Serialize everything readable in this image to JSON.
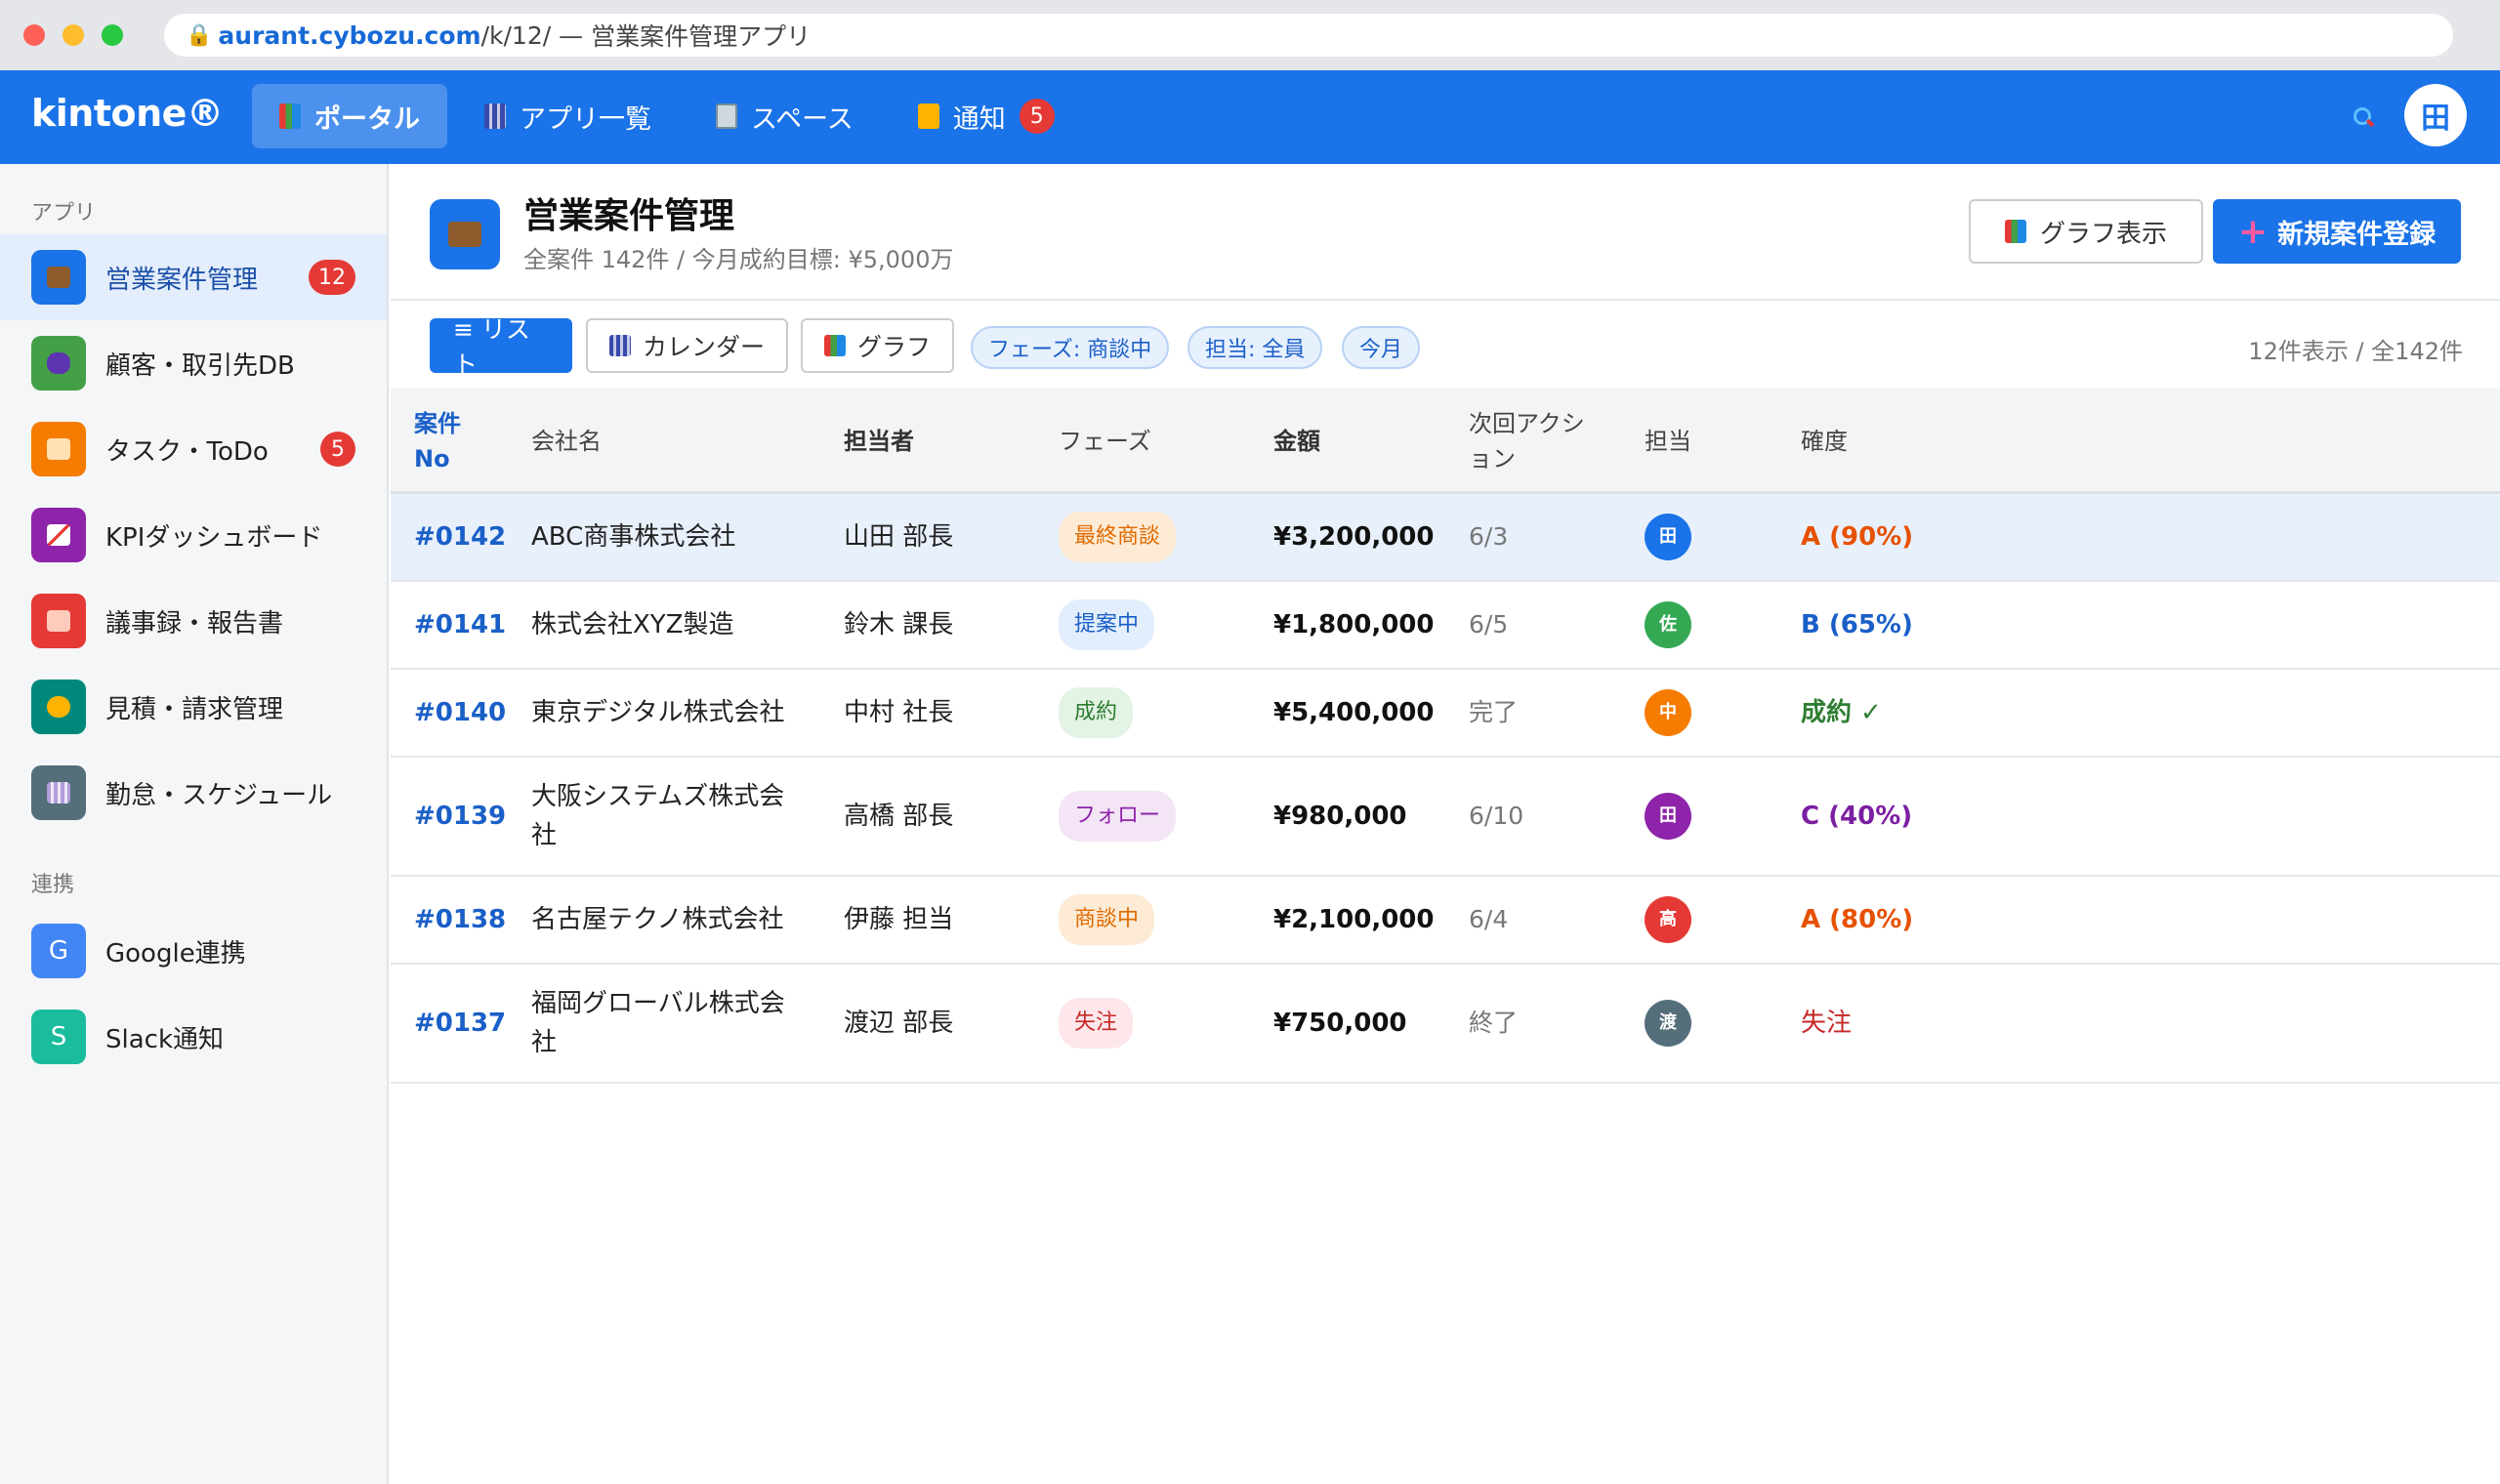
{
  "browser": {
    "url_host": "aurant.cybozu.com",
    "url_path": "/k/12/",
    "title_sep": " — ",
    "title": "営業案件管理アプリ",
    "lock_icon": "lock-icon"
  },
  "topbar": {
    "logo": "kintone®",
    "nav": [
      {
        "label": "ポータル",
        "icon": "portal-icon"
      },
      {
        "label": "アプリ一覧",
        "icon": "apps-icon"
      },
      {
        "label": "スペース",
        "icon": "space-icon"
      },
      {
        "label": "通知",
        "icon": "bell-icon",
        "badge": "5"
      }
    ],
    "avatar": "田",
    "accent": "#1a73e8"
  },
  "sidebar": {
    "section_apps": "アプリ",
    "section_links": "連携",
    "apps": [
      {
        "label": "営業案件管理",
        "badge": "12",
        "color": "#1a73e8"
      },
      {
        "label": "顧客・取引先DB",
        "color": "#43a047"
      },
      {
        "label": "タスク・ToDo",
        "badge": "5",
        "color": "#f57c00"
      },
      {
        "label": "KPIダッシュボード",
        "color": "#8e24aa"
      },
      {
        "label": "議事録・報告書",
        "color": "#e53935"
      },
      {
        "label": "見積・請求管理",
        "color": "#00897b"
      },
      {
        "label": "勤怠・スケジュール",
        "color": "#546e7a"
      }
    ],
    "links": [
      {
        "label": "Google連携",
        "letter": "G",
        "color": "#4285f4"
      },
      {
        "label": "Slack通知",
        "letter": "S",
        "color": "#1abc9c"
      }
    ]
  },
  "app": {
    "title": "営業案件管理",
    "subtitle": "全案件 142件 / 今月成約目標: ¥5,000万",
    "graph_button": "グラフ表示",
    "new_button_plus": "+",
    "new_button": "新規案件登録"
  },
  "toolbar": {
    "list": "≡ リスト",
    "calendar": "カレンダー",
    "graph": "グラフ",
    "chip_phase": "フェーズ: 商談中",
    "chip_owner": "担当: 全員",
    "chip_month": "今月",
    "count": "12件表示 / 全142件"
  },
  "table": {
    "headers": {
      "no_1": "案件",
      "no_2": "No",
      "company": "会社名",
      "contact": "担当者",
      "phase": "フェーズ",
      "amount": "金額",
      "next_1": "次回アクシ",
      "next_2": "ョン",
      "owner": "担当",
      "prob": "確度"
    },
    "rows": [
      {
        "no": "#0142",
        "company": "ABC商事株式会社",
        "contact": "山田 部長",
        "phase": "最終商談",
        "amount": "¥3,200,000",
        "next": "6/3",
        "owner": "田",
        "prob": "A (90%)"
      },
      {
        "no": "#0141",
        "company": "株式会社XYZ製造",
        "contact": "鈴木 課長",
        "phase": "提案中",
        "amount": "¥1,800,000",
        "next": "6/5",
        "owner": "佐",
        "prob": "B (65%)"
      },
      {
        "no": "#0140",
        "company": "東京デジタル株式会社",
        "contact": "中村 社長",
        "phase": "成約",
        "amount": "¥5,400,000",
        "next": "完了",
        "owner": "中",
        "prob": "成約 ✓"
      },
      {
        "no": "#0139",
        "company_1": "大阪システムズ株式会",
        "company_2": "社",
        "contact": "高橋 部長",
        "phase": "フォロー",
        "amount": "¥980,000",
        "next": "6/10",
        "owner": "田",
        "prob": "C (40%)"
      },
      {
        "no": "#0138",
        "company": "名古屋テクノ株式会社",
        "contact": "伊藤 担当",
        "phase": "商談中",
        "amount": "¥2,100,000",
        "next": "6/4",
        "owner": "高",
        "prob": "A (80%)"
      },
      {
        "no": "#0137",
        "company_1": "福岡グローバル株式会",
        "company_2": "社",
        "contact": "渡辺 部長",
        "phase": "失注",
        "amount": "¥750,000",
        "next": "終了",
        "owner": "渡",
        "prob": "失注"
      }
    ]
  }
}
